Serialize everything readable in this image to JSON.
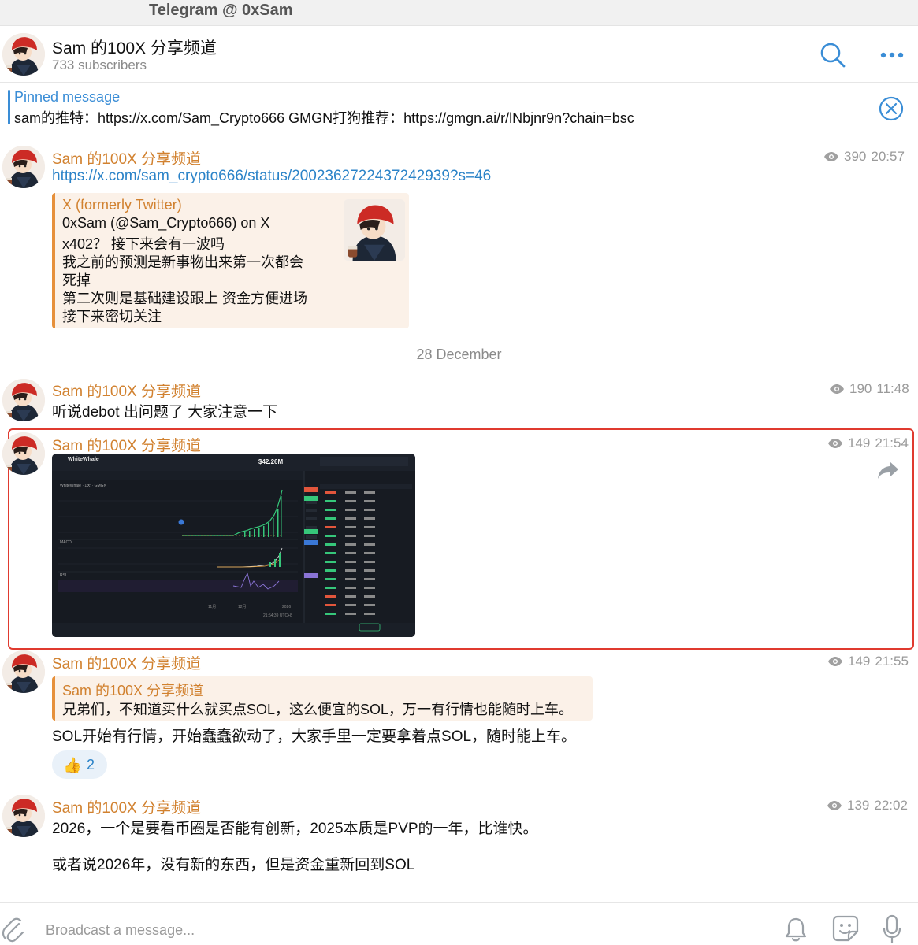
{
  "window": {
    "title": "Telegram @ 0xSam"
  },
  "channel": {
    "title": "Sam 的100X 分享频道",
    "subtitle": "733 subscribers"
  },
  "pinned": {
    "label": "Pinned message",
    "text": "sam的推特：https://x.com/Sam_Crypto666 GMGN打狗推荐：https://gmgn.ai/r/lNbjnr9n?chain=bsc"
  },
  "messages": [
    {
      "sender": "Sam 的100X 分享频道",
      "views": "390",
      "time": "20:57",
      "link": "https://x.com/sam_crypto666/status/2002362722437242939?s=46",
      "preview": {
        "site": "X (formerly Twitter)",
        "title": "0xSam (@Sam_Crypto666) on X",
        "lines": [
          "x402？ 接下来会有一波吗",
          "我之前的预测是新事物出来第一次都会",
          "死掉",
          "第二次则是基础建设跟上 资金方便进场",
          "接下来密切关注"
        ]
      }
    },
    {
      "sender": "Sam 的100X 分享频道",
      "views": "190",
      "time": "11:48",
      "text": "听说debot 出问题了 大家注意一下"
    },
    {
      "sender": "Sam 的100X 分享频道",
      "views": "149",
      "time": "21:54",
      "image": {
        "token": "WhiteWhale",
        "price": "$42.26M",
        "pair": "WhiteWhale · 1天 · GMGN",
        "clock": "21:54:39 UTC+8",
        "year": "2026",
        "axis_month_1": "11月",
        "axis_month_2": "12月",
        "macd_label": "MACD",
        "rsi_label": "RSI"
      }
    },
    {
      "sender": "Sam 的100X 分享频道",
      "views": "149",
      "time": "21:55",
      "reply_to": {
        "sender": "Sam 的100X 分享频道",
        "text": "兄弟们，不知道买什么就买点SOL，这么便宜的SOL，万一有行情也能随时上车。"
      },
      "text": "SOL开始有行情，开始蠢蠢欲动了，大家手里一定要拿着点SOL，随时能上车。",
      "reaction": {
        "emoji": "👍",
        "count": "2"
      }
    },
    {
      "sender": "Sam 的100X 分享频道",
      "views": "139",
      "time": "22:02",
      "text_1": "2026，一个是要看币圈是否能有创新，2025本质是PVP的一年，比谁快。",
      "text_2": "或者说2026年，没有新的东西，但是资金重新回到SOL"
    }
  ],
  "date_separator": "28 December",
  "composer": {
    "placeholder": "Broadcast a message..."
  },
  "icons": {
    "search": "search-icon",
    "more": "more-icon",
    "close": "close-icon",
    "views": "eye-icon",
    "forward": "forward-icon",
    "attach": "paperclip-icon",
    "bell": "bell-icon",
    "sticker": "sticker-icon",
    "mic": "microphone-icon"
  },
  "colors": {
    "accent": "#3a8dd6",
    "sender": "#d1812f",
    "highlight": "#e03a2f"
  }
}
